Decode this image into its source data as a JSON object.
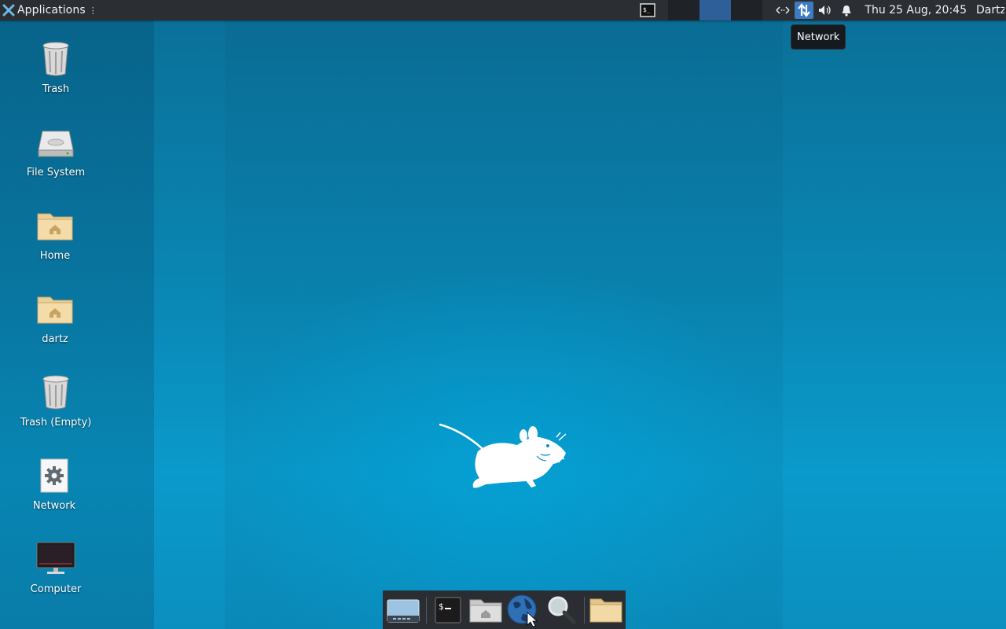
{
  "top_panel": {
    "applications_label": "Applications",
    "clock": "Thu 25 Aug, 20:45",
    "user": "Dartz",
    "tray_icons": [
      "network-arrows-icon",
      "network-updown-icon",
      "volume-icon",
      "bell-icon"
    ]
  },
  "tooltip": {
    "text": "Network"
  },
  "desktop_icons": [
    {
      "label": "Trash",
      "icon": "trash-icon"
    },
    {
      "label": "File System",
      "icon": "drive-icon"
    },
    {
      "label": "Home",
      "icon": "home-folder-icon"
    },
    {
      "label": "dartz",
      "icon": "home-folder-icon"
    },
    {
      "label": "Trash (Empty)",
      "icon": "trash-icon"
    },
    {
      "label": "Network",
      "icon": "gear-icon"
    },
    {
      "label": "Computer",
      "icon": "monitor-icon"
    }
  ],
  "dock": {
    "items": [
      "show-desktop-icon",
      "terminal-icon",
      "home-folder-icon",
      "web-browser-icon",
      "search-icon",
      "folder-icon"
    ]
  }
}
